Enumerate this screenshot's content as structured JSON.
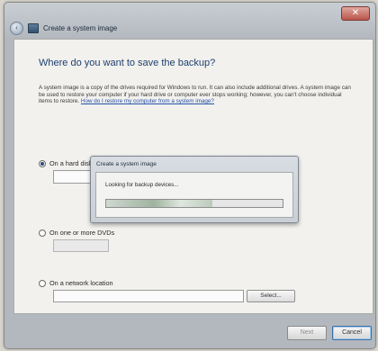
{
  "window": {
    "breadcrumb": "Create a system image",
    "close_label": "✕"
  },
  "page": {
    "heading": "Where do you want to save the backup?",
    "description": "A system image is a copy of the drives required for Windows to run. It can also include additional drives. A system image can be used to restore your computer if your hard drive or computer ever stops working; however, you can't choose individual items to restore.",
    "description_link": "How do I restore my computer from a system image?"
  },
  "options": {
    "hard_disk": {
      "label": "On a hard disk",
      "selected": true
    },
    "dvd": {
      "label": "On one or more DVDs",
      "selected": false
    },
    "network": {
      "label": "On a network location",
      "selected": false
    }
  },
  "network_browse_label": "Select...",
  "footer": {
    "next_label": "Next",
    "cancel_label": "Cancel"
  },
  "dialog": {
    "title": "Create a system image",
    "message": "Looking for backup devices...",
    "progress": 0.6
  }
}
